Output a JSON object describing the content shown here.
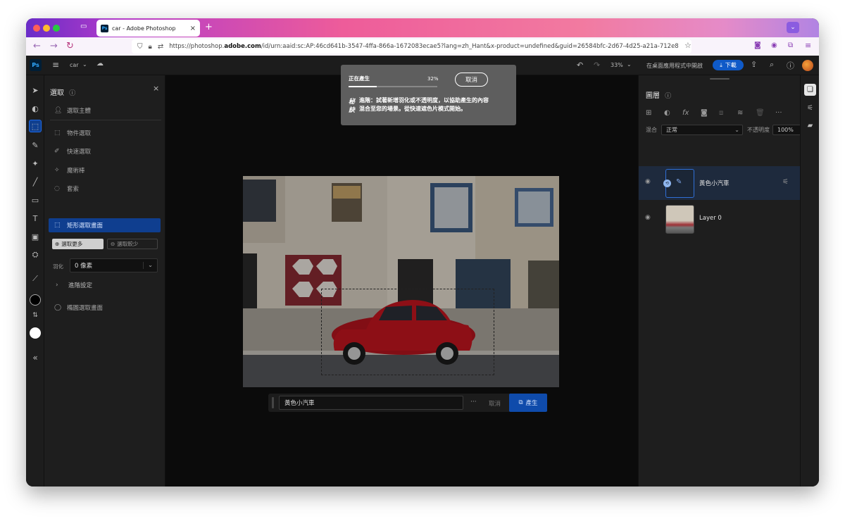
{
  "browser": {
    "tab_title": "car - Adobe Photoshop",
    "tab_close": "×",
    "new_tab": "+",
    "url_prefix": "https://photoshop.",
    "url_domain": "adobe.com",
    "url_rest": "/id/urn:aaid:sc:AP:46cd641b-3547-4ffa-866a-1672083ecae5?lang=zh_Hant&x-product=undefined&guid=26584bfc-2d67-4d25-a21a-712e8",
    "back": "←",
    "forward": "→",
    "reload": "↻"
  },
  "appbar": {
    "logo": "Ps",
    "menu_icon": "≡",
    "doc_name": "car",
    "zoom": "33%",
    "open_desktop": "在桌面應用程式中開啟",
    "download": "下載"
  },
  "select_panel": {
    "title": "選取",
    "close": "×",
    "items": [
      {
        "label": "選取主體"
      },
      {
        "label": "物件選取"
      },
      {
        "label": "快速選取"
      },
      {
        "label": "魔術棒"
      },
      {
        "label": "套索"
      },
      {
        "label": "矩形選取畫面"
      }
    ],
    "select_more": "選取更多",
    "select_less": "選取較少",
    "feather_label": "羽化",
    "feather_value": "0 像素",
    "advanced": "進階設定",
    "ellipse": "橢圓選取畫面"
  },
  "progress_dialog": {
    "label": "正在產生",
    "percent": "32%",
    "progress": 0.32,
    "cancel": "取消",
    "tip_mark": "秘訣",
    "tip_text": "進階：試著新增羽化或不透明度，以協助產生的內容混合至您的場景。從快速遮色片模式開始。"
  },
  "prompt_bar": {
    "value": "黃色小汽車",
    "more": "···",
    "cancel": "取消",
    "generate": "產生"
  },
  "layers_panel": {
    "title": "圖層",
    "blend_label": "混合",
    "blend_value": "正常",
    "opacity_label": "不透明度",
    "opacity_value": "100%",
    "layers": [
      {
        "name": "黃色小汽車"
      },
      {
        "name": "Layer 0"
      }
    ]
  },
  "colors": {
    "accent": "#0f4bab",
    "foreground": "#000000",
    "background": "#ffffff"
  }
}
